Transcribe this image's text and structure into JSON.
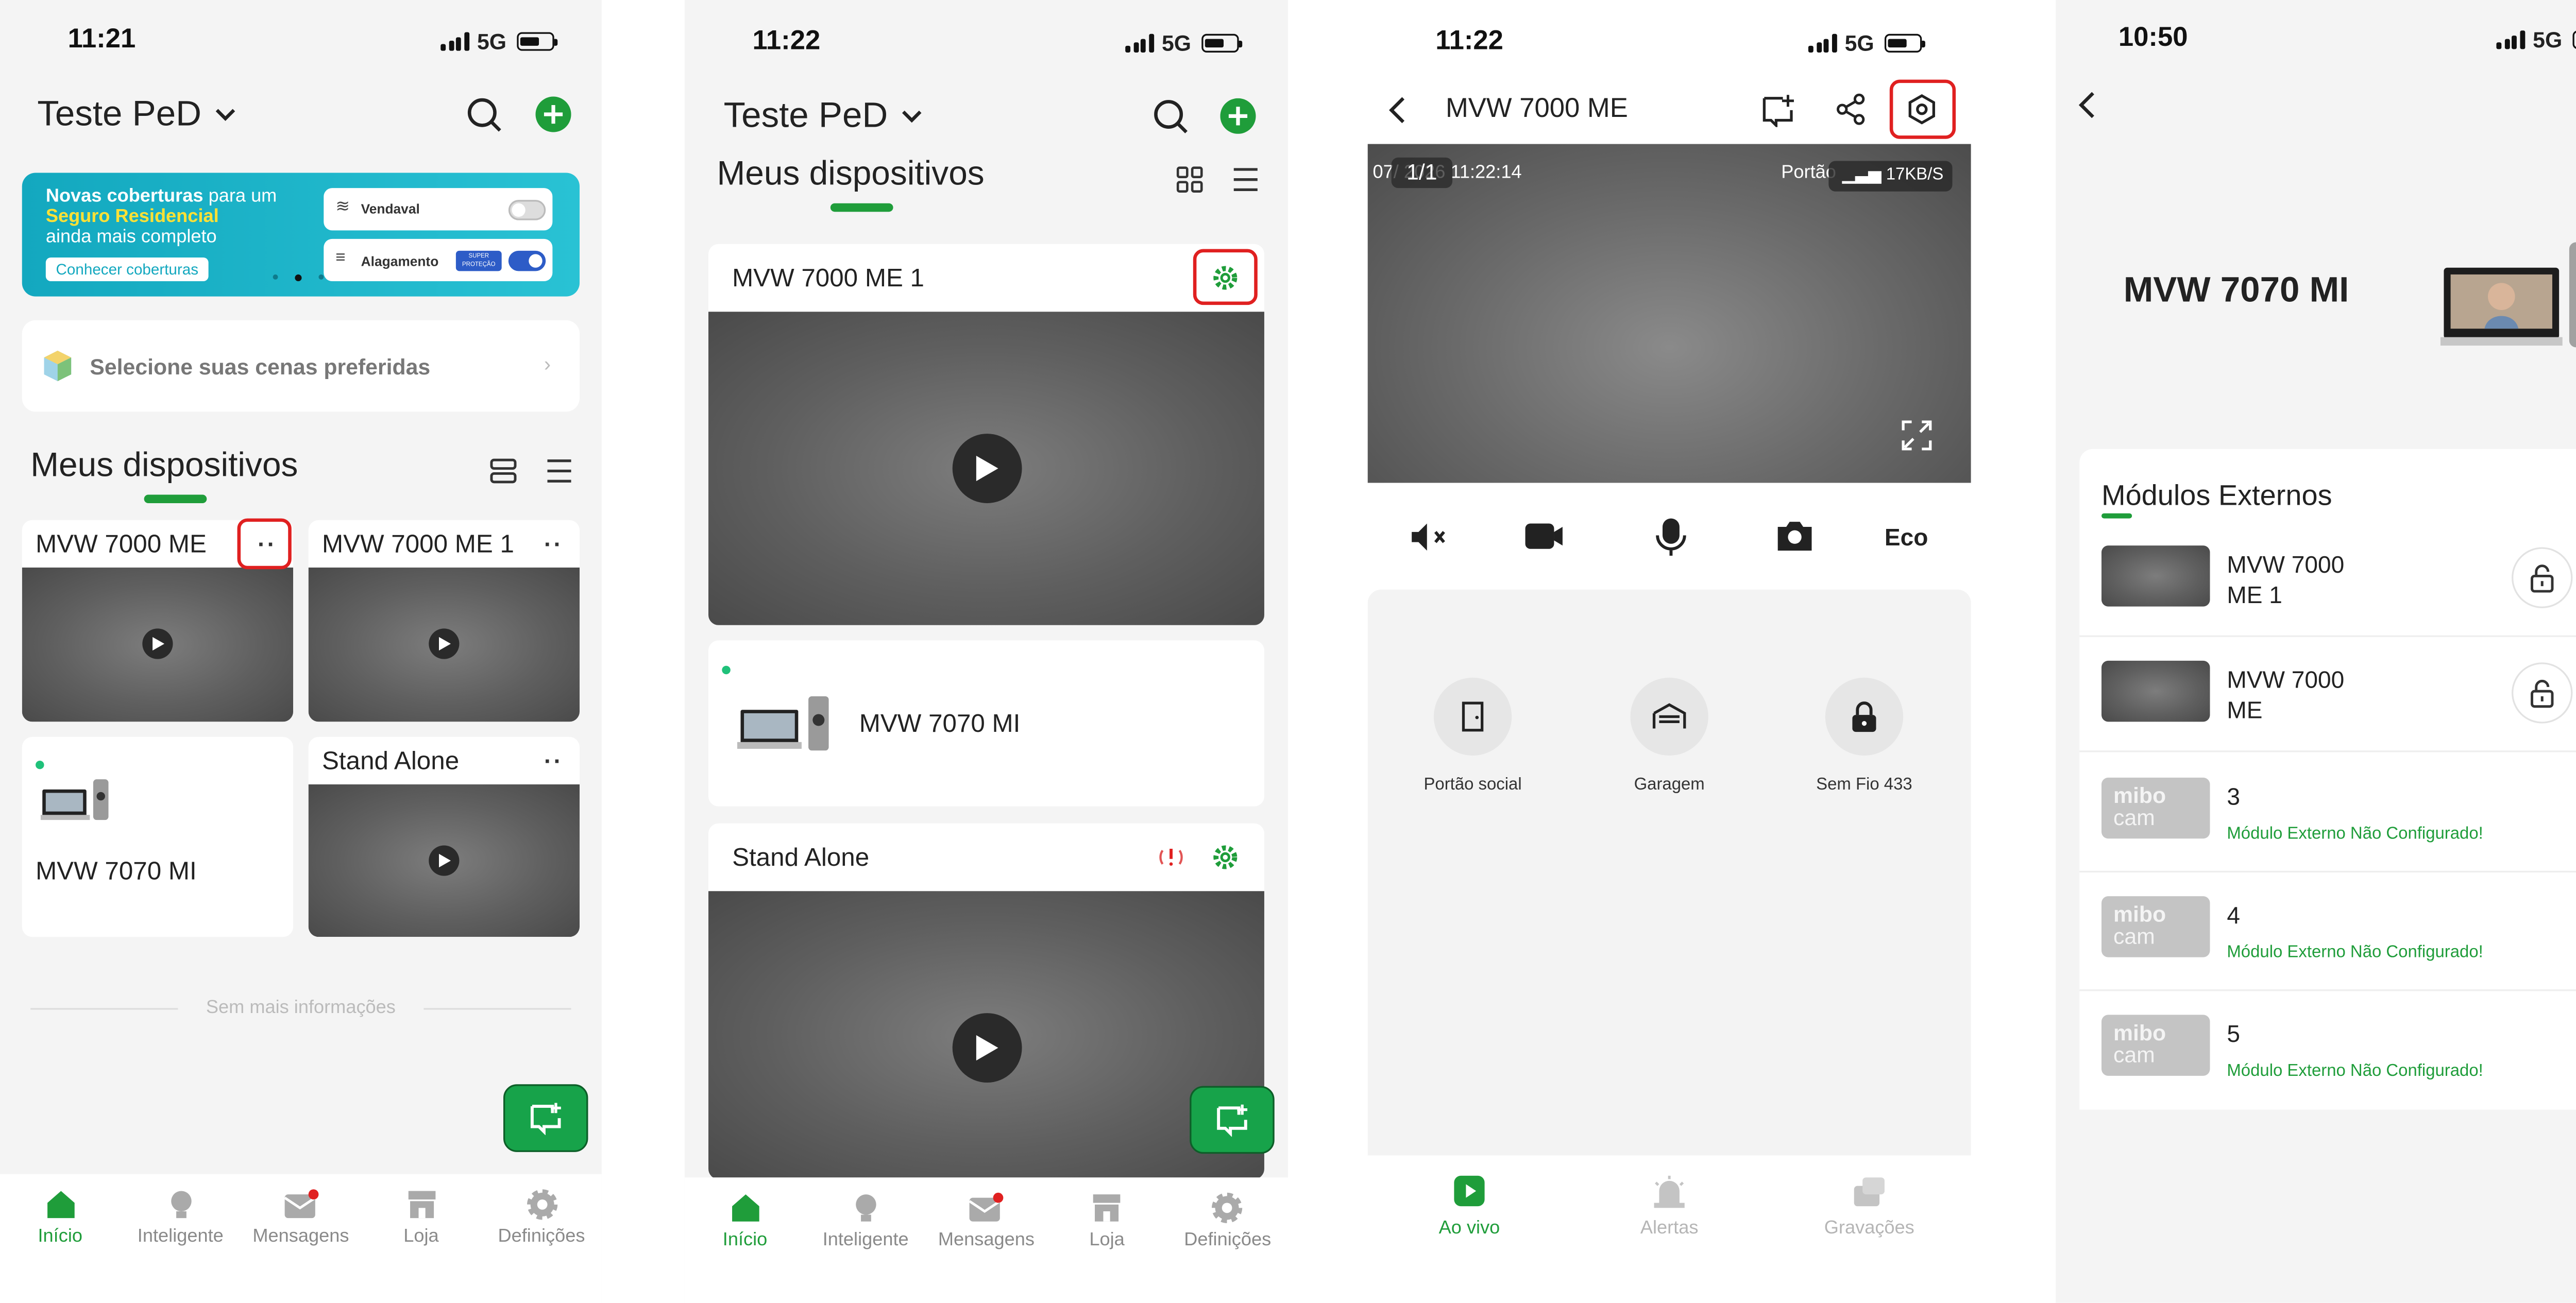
{
  "status_bars": [
    {
      "time": "11:21",
      "network": "5G"
    },
    {
      "time": "11:22",
      "network": "5G"
    },
    {
      "time": "11:22",
      "network": "5G"
    },
    {
      "time": "10:50",
      "network": "5G"
    }
  ],
  "screen1": {
    "home_title": "Teste PeD",
    "banner": {
      "line1_bold": "Novas coberturas",
      "line1_rest": " para um",
      "line2": "Seguro Residencial",
      "line3": "ainda mais completo",
      "cta": "Conhecer coberturas",
      "toggle1_label": "Vendaval",
      "toggle2_label": "Alagamento",
      "badge": "SUPER PROTEÇÃO"
    },
    "scenes_text": "Selecione suas cenas preferidas",
    "section_title": "Meus dispositivos",
    "devices": [
      {
        "name": "MVW 7000 ME",
        "more": "··"
      },
      {
        "name": "MVW 7000 ME 1",
        "more": "··"
      },
      {
        "name": "MVW 7070 MI"
      },
      {
        "name": "Stand Alone",
        "more": "··"
      }
    ],
    "footer_note": "Sem mais informações"
  },
  "tabs": [
    {
      "label": "Início",
      "icon": "home-icon"
    },
    {
      "label": "Inteligente",
      "icon": "bulb-icon"
    },
    {
      "label": "Mensagens",
      "icon": "mail-icon"
    },
    {
      "label": "Loja",
      "icon": "store-icon"
    },
    {
      "label": "Definições",
      "icon": "gear-icon"
    }
  ],
  "screen2": {
    "home_title": "Teste PeD",
    "section_title": "Meus dispositivos",
    "devices": [
      {
        "name": "MVW 7000 ME 1"
      },
      {
        "name": "MVW 7070 MI"
      },
      {
        "name": "Stand Alone"
      }
    ]
  },
  "screen3": {
    "title": "MVW 7000 ME",
    "video_counter": "1/1",
    "video_date": "07/  2026 11:22:14",
    "video_label": "Portão",
    "speed": "17KB/S",
    "eco_label": "Eco",
    "actions": [
      {
        "label": "Portão social",
        "icon": "door-icon"
      },
      {
        "label": "Garagem",
        "icon": "garage-icon"
      },
      {
        "label": "Sem Fio 433",
        "icon": "lock-icon"
      }
    ],
    "tabs": [
      {
        "label": "Ao vivo"
      },
      {
        "label": "Alertas"
      },
      {
        "label": "Gravações"
      }
    ]
  },
  "screen4": {
    "device_title": "MVW 7070 MI",
    "section_title": "Módulos Externos",
    "modules": [
      {
        "name_line1": "MVW 7000",
        "name_line2": "ME 1"
      },
      {
        "name_line1": "MVW 7000",
        "name_line2": "ME"
      },
      {
        "number": "3",
        "status": "Módulo Externo Não Configurado!",
        "logo_top": "mibo",
        "logo_bottom": "cam"
      },
      {
        "number": "4",
        "status": "Módulo Externo Não Configurado!",
        "logo_top": "mibo",
        "logo_bottom": "cam"
      },
      {
        "number": "5",
        "status": "Módulo Externo Não Configurado!",
        "logo_top": "mibo",
        "logo_bottom": "cam"
      }
    ]
  },
  "colors": {
    "accent": "#1f9d3a",
    "highlight": "#e02020",
    "banner": "#1fb5c9"
  }
}
